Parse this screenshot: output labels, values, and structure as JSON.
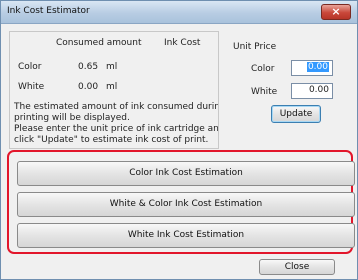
{
  "window": {
    "title": "Ink Cost Estimator",
    "close_glyph": "×"
  },
  "header": {
    "consumed": "Consumed amount",
    "ink_cost": "Ink Cost",
    "unit_price": "Unit Price"
  },
  "rows": [
    {
      "label": "Color",
      "amount": "0.65",
      "unit": "ml"
    },
    {
      "label": "White",
      "amount": "0.00",
      "unit": "ml"
    }
  ],
  "note": [
    "The estimated amount of ink consumed during",
    "printing will be displayed.",
    "Please enter the unit price of ink cartridge and",
    "click \"Update\" to estimate ink cost of print."
  ],
  "price": {
    "color_label": "Color",
    "color_value": "0.00",
    "white_label": "White",
    "white_value": "0.00",
    "update_label": "Update"
  },
  "buttons": {
    "color_estimation": "Color Ink Cost Estimation",
    "white_color_estimation": "White & Color Ink Cost Estimation",
    "white_estimation": "White Ink Cost Estimation",
    "close": "Close"
  },
  "colors": {
    "highlight_border": "#e2162b",
    "selection": "#3399ff"
  }
}
